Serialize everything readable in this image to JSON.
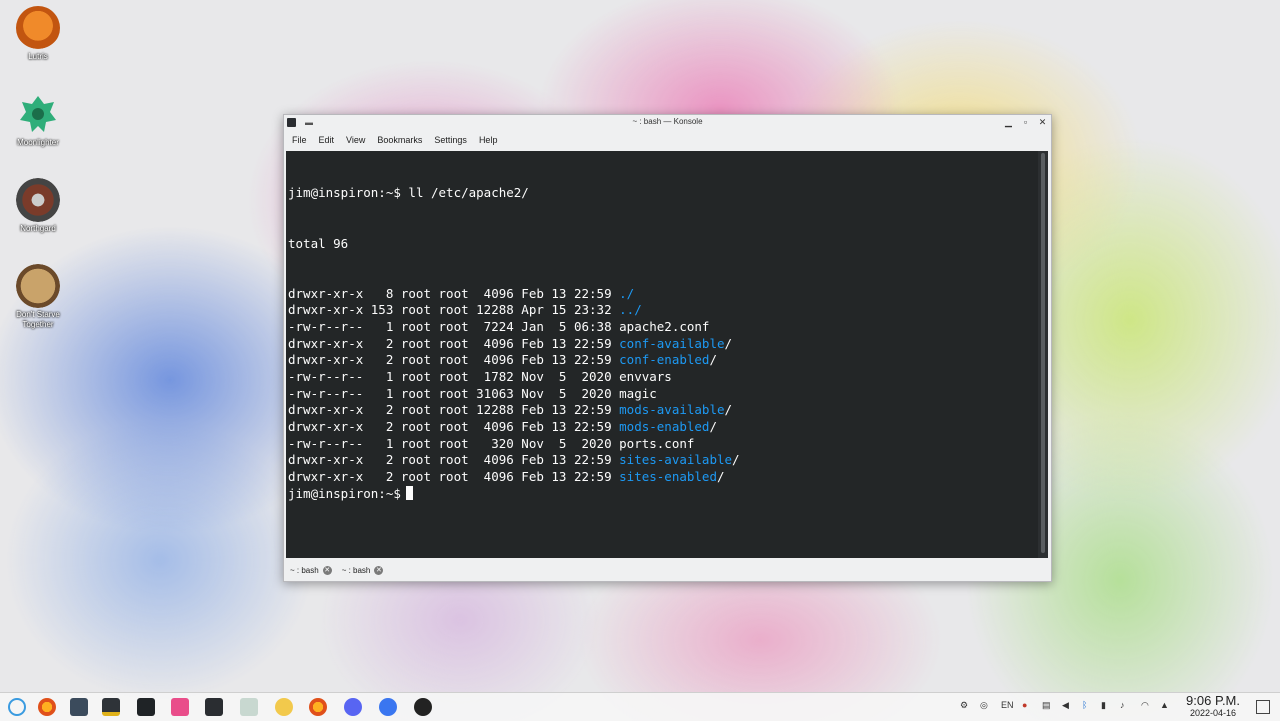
{
  "desktop": {
    "icons": [
      {
        "label": "Lutris"
      },
      {
        "label": "Moonlighter"
      },
      {
        "label": "Northgard"
      },
      {
        "label": "Don't Starve Together"
      }
    ]
  },
  "window": {
    "title": "~ : bash — Konsole",
    "menu": [
      "File",
      "Edit",
      "View",
      "Bookmarks",
      "Settings",
      "Help"
    ],
    "tabs": [
      {
        "label": "~ : bash"
      },
      {
        "label": "~ : bash"
      }
    ]
  },
  "terminal": {
    "prompt": "jim@inspiron:~$",
    "command": " ll /etc/apache2/",
    "total": "total 96",
    "rows": [
      {
        "meta": "drwxr-xr-x   8 root root  4096 Feb 13 22:59 ",
        "name": "./"
      },
      {
        "meta": "drwxr-xr-x 153 root root 12288 Apr 15 23:32 ",
        "name": "../"
      },
      {
        "meta": "-rw-r--r--   1 root root  7224 Jan  5 06:38 ",
        "name": "apache2.conf"
      },
      {
        "meta": "drwxr-xr-x   2 root root  4096 Feb 13 22:59 ",
        "name": "conf-available",
        "suffix": "/"
      },
      {
        "meta": "drwxr-xr-x   2 root root  4096 Feb 13 22:59 ",
        "name": "conf-enabled",
        "suffix": "/"
      },
      {
        "meta": "-rw-r--r--   1 root root  1782 Nov  5  2020 ",
        "name": "envvars"
      },
      {
        "meta": "-rw-r--r--   1 root root 31063 Nov  5  2020 ",
        "name": "magic"
      },
      {
        "meta": "drwxr-xr-x   2 root root 12288 Feb 13 22:59 ",
        "name": "mods-available",
        "suffix": "/"
      },
      {
        "meta": "drwxr-xr-x   2 root root  4096 Feb 13 22:59 ",
        "name": "mods-enabled",
        "suffix": "/"
      },
      {
        "meta": "-rw-r--r--   1 root root   320 Nov  5  2020 ",
        "name": "ports.conf"
      },
      {
        "meta": "drwxr-xr-x   2 root root  4096 Feb 13 22:59 ",
        "name": "sites-available",
        "suffix": "/"
      },
      {
        "meta": "drwxr-xr-x   2 root root  4096 Feb 13 22:59 ",
        "name": "sites-enabled",
        "suffix": "/"
      }
    ]
  },
  "taskbar": {
    "keyboard_layout": "EN",
    "time": "9:06 P.M.",
    "date": "2022-04-16"
  },
  "colors": {
    "terminal_bg": "#232627",
    "directory": "#1d99f3"
  }
}
